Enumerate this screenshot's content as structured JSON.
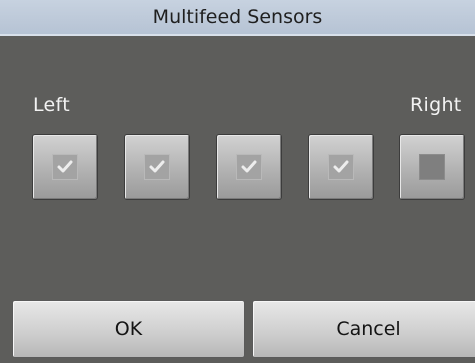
{
  "window": {
    "title": "Multifeed Sensors"
  },
  "labels": {
    "left": "Left",
    "right": "Right"
  },
  "sensors": [
    {
      "checked": true,
      "icon": "checkmark-icon"
    },
    {
      "checked": true,
      "icon": "checkmark-icon"
    },
    {
      "checked": true,
      "icon": "checkmark-icon"
    },
    {
      "checked": true,
      "icon": "checkmark-icon"
    },
    {
      "checked": false,
      "icon": "empty-checkbox-icon"
    }
  ],
  "buttons": {
    "ok": "OK",
    "cancel": "Cancel"
  },
  "colors": {
    "background": "#5d5d5b",
    "titlebar": "#c2cddc",
    "check": "#ededed"
  }
}
